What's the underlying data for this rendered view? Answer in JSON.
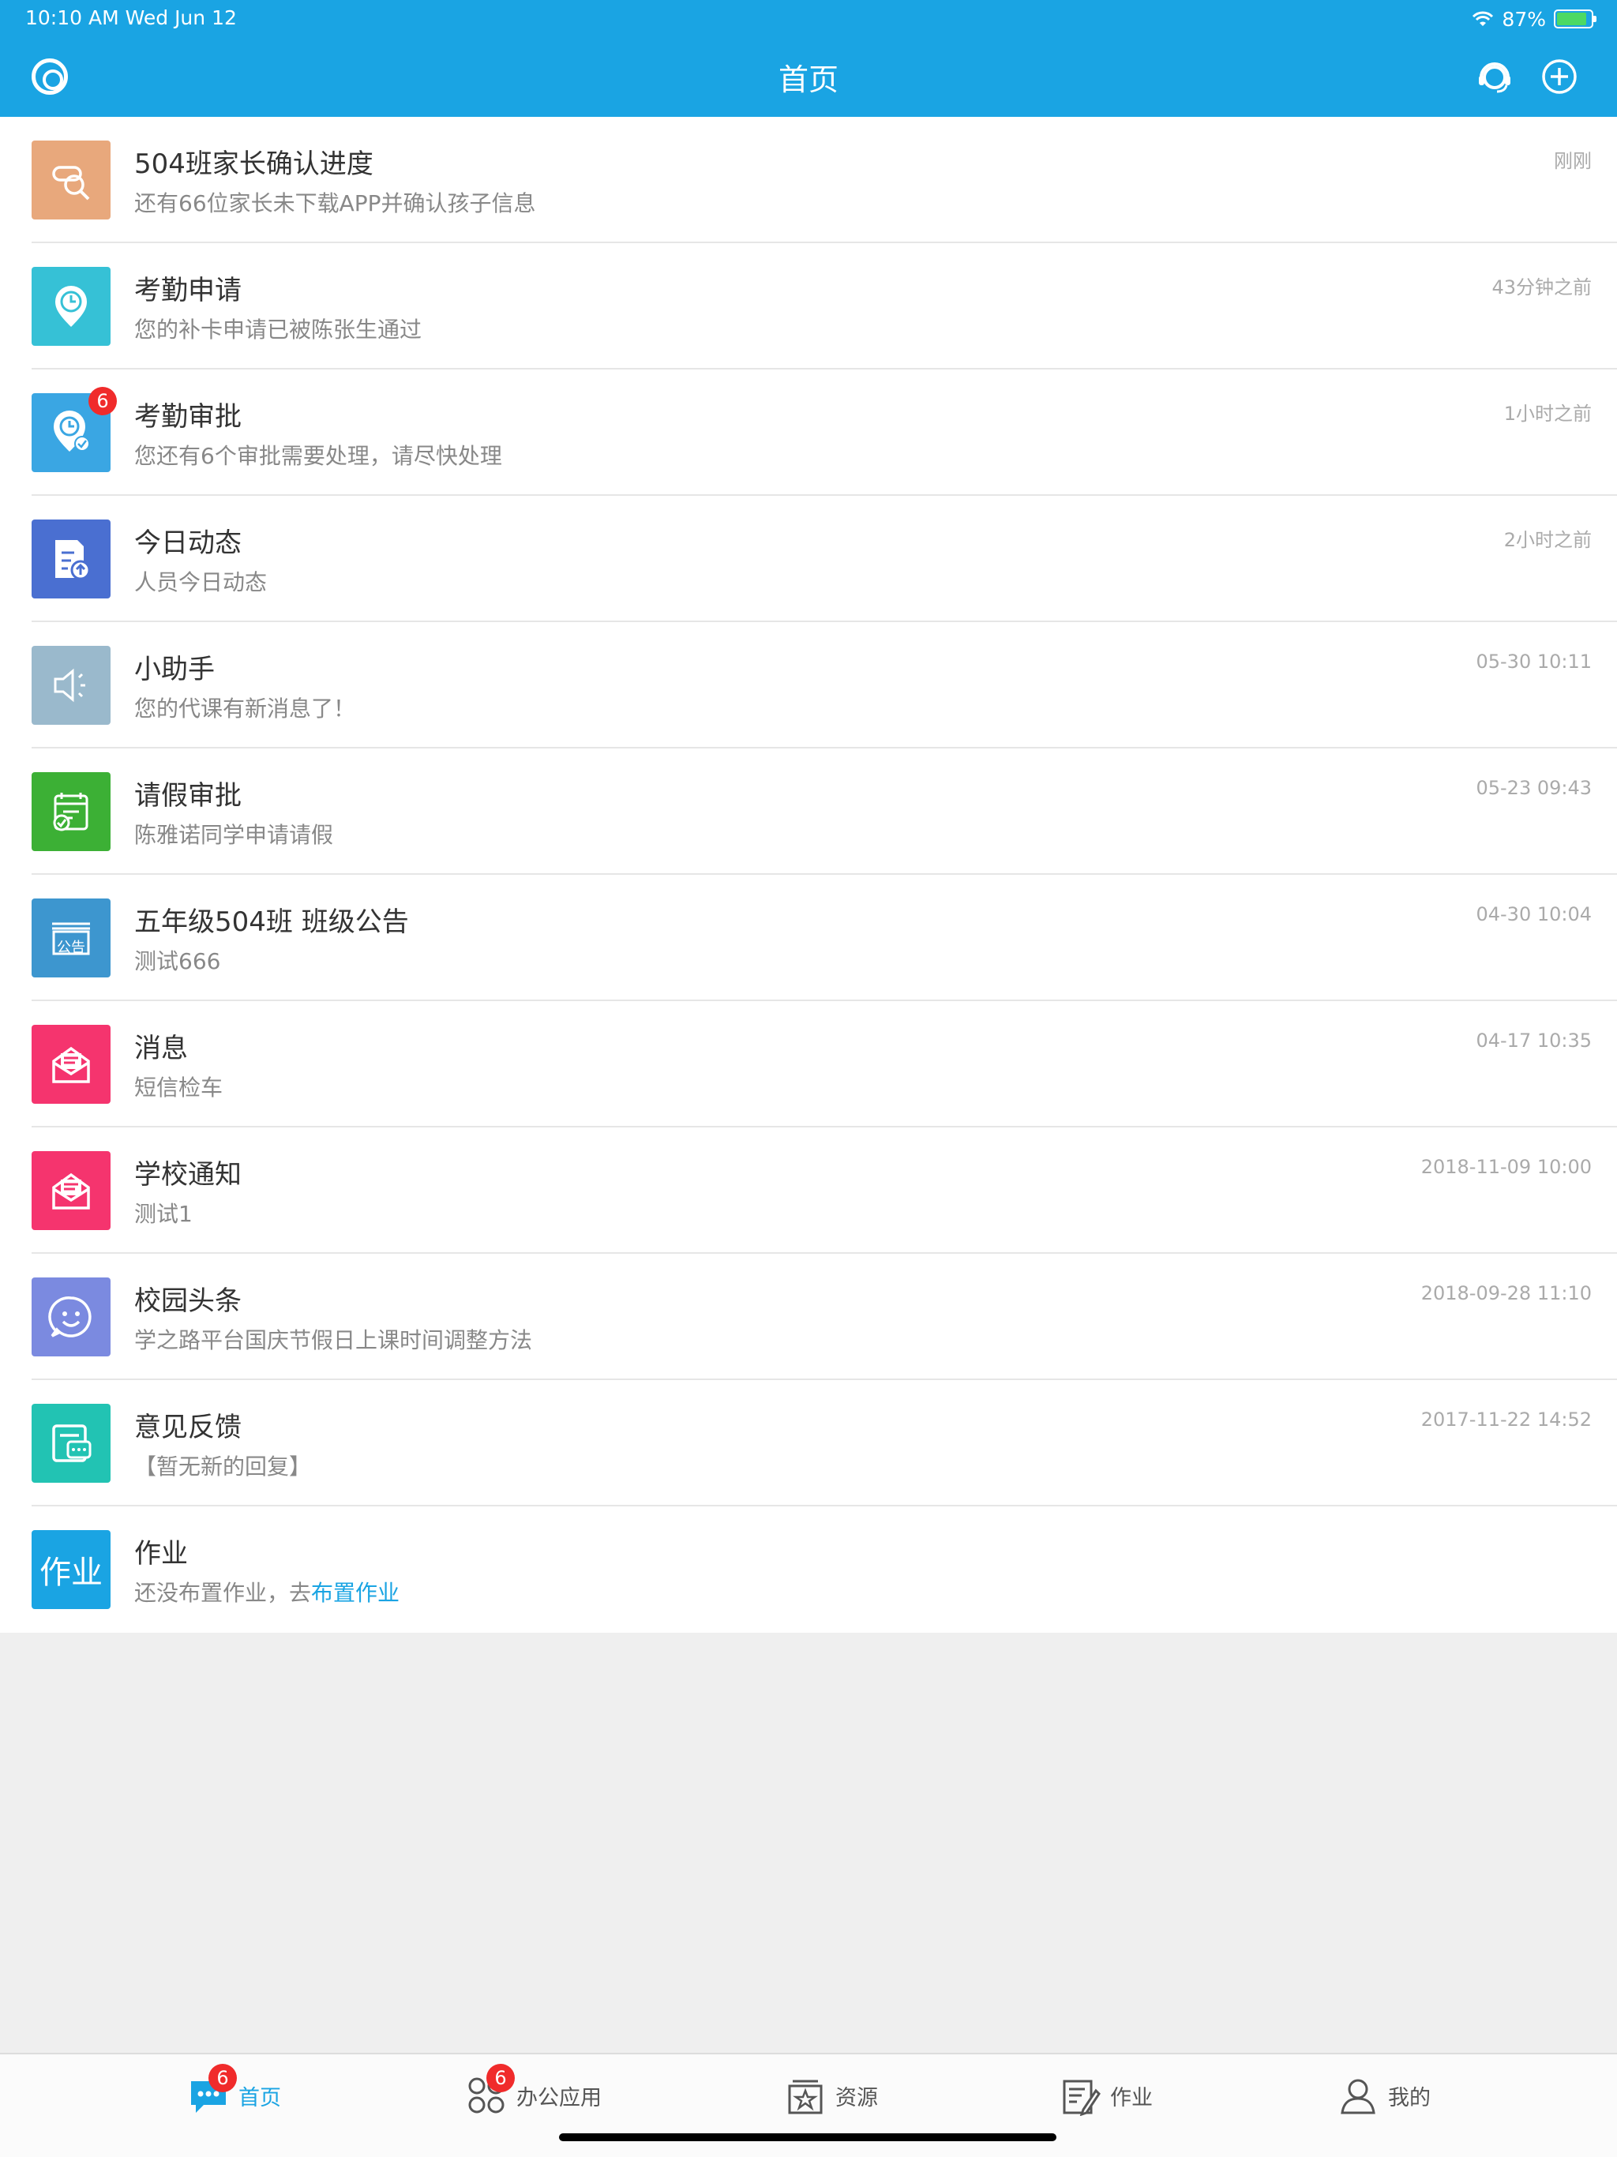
{
  "status_bar": {
    "time": "10:10 AM   Wed Jun 12",
    "battery": "87%",
    "battery_level": 0.87
  },
  "nav": {
    "title": "首页"
  },
  "colors": {
    "accent": "#1aa4e3",
    "badge": "#f02b2b"
  },
  "messages": [
    {
      "icon": "parent-confirm-icon",
      "color": "#e8a87c",
      "title": "504班家长确认进度",
      "subtitle": "还有66位家长未下载APP并确认孩子信息",
      "time": "刚刚"
    },
    {
      "icon": "attendance-request-icon",
      "color": "#36c1d6",
      "title": "考勤申请",
      "subtitle": "您的补卡申请已被陈张生通过",
      "time": "43分钟之前"
    },
    {
      "icon": "attendance-approval-icon",
      "color": "#3aa6e3",
      "title": "考勤审批",
      "subtitle": "您还有6个审批需要处理，请尽快处理",
      "time": "1小时之前",
      "badge": "6"
    },
    {
      "icon": "daily-update-icon",
      "color": "#4a6fd1",
      "title": "今日动态",
      "subtitle": "人员今日动态",
      "time": "2小时之前"
    },
    {
      "icon": "speaker-icon",
      "color": "#9ab9cc",
      "title": "小助手",
      "subtitle": "您的代课有新消息了！",
      "time": "05-30 10:11"
    },
    {
      "icon": "leave-approval-icon",
      "color": "#3cb035",
      "title": "请假审批",
      "subtitle": "陈雅诺同学申请请假",
      "time": "05-23 09:43"
    },
    {
      "icon": "announcement-icon",
      "color": "#3d96cf",
      "title": "五年级504班 班级公告",
      "subtitle": "测试666",
      "time": "04-30 10:04",
      "icon_text": "公告"
    },
    {
      "icon": "envelope-icon",
      "color": "#f5346e",
      "title": "消息",
      "subtitle": "短信检车",
      "time": "04-17 10:35"
    },
    {
      "icon": "envelope-icon",
      "color": "#f5346e",
      "title": "学校通知",
      "subtitle": "测试1",
      "time": "2018-11-09 10:00"
    },
    {
      "icon": "smiley-chat-icon",
      "color": "#7b8ae0",
      "title": "校园头条",
      "subtitle": "学之路平台国庆节假日上课时间调整方法",
      "time": "2018-09-28 11:10"
    },
    {
      "icon": "feedback-icon",
      "color": "#22c3b3",
      "title": "意见反馈",
      "subtitle": "【暂无新的回复】",
      "time": "2017-11-22 14:52"
    },
    {
      "icon": "homework-icon",
      "color": "#1aa4e3",
      "title": "作业",
      "subtitle": "还没布置作业，去",
      "link": "布置作业",
      "time": "",
      "icon_text": "作业"
    }
  ],
  "tabs": [
    {
      "label": "首页",
      "icon": "chat-bubble-icon",
      "badge": "6",
      "active": true
    },
    {
      "label": "办公应用",
      "icon": "apps-grid-icon",
      "badge": "6"
    },
    {
      "label": "资源",
      "icon": "resource-star-icon"
    },
    {
      "label": "作业",
      "icon": "homework-edit-icon"
    },
    {
      "label": "我的",
      "icon": "profile-icon"
    }
  ]
}
